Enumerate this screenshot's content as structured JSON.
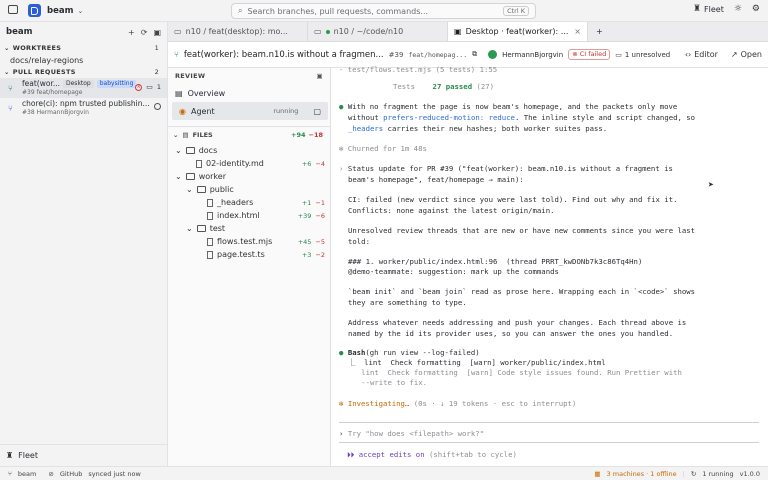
{
  "app": {
    "name": "beam"
  },
  "search": {
    "placeholder": "Search branches, pull requests, commands...",
    "shortcut": "Ctrl K"
  },
  "titlebar_right": {
    "fleet_label": "Fleet"
  },
  "sidebar": {
    "title": "beam",
    "worktrees": {
      "label": "WORKTREES",
      "count": "1",
      "items": [
        "docs/relay-regions"
      ]
    },
    "pull_requests": {
      "label": "PULL REQUESTS",
      "count": "2",
      "items": [
        {
          "title": "feat(wor...",
          "badge1": "Desktop",
          "badge2": "babysitting",
          "sub": "#39 feat/homepage",
          "comments": "1"
        },
        {
          "title": "chore(ci): npm trusted publishin...",
          "sub": "#38 HermannBjorgvin"
        }
      ]
    },
    "fleet_label": "Fleet"
  },
  "tabs": [
    {
      "label": "n10 / feat(desktop): mo..."
    },
    {
      "label": "n10 / ~/code/n10"
    },
    {
      "label": "Desktop · feat(worker): ..."
    }
  ],
  "pr_header": {
    "title": "feat(worker): beam.n10.is without a fragmen...",
    "number": "#39",
    "branch": "feat/homepag...",
    "author": "HermannBjorgvin",
    "ci": "CI failed",
    "unresolved": "1 unresolved",
    "editor": "Editor",
    "open": "Open"
  },
  "review": {
    "label": "REVIEW",
    "overview": "Overview",
    "agent": "Agent",
    "agent_status": "running",
    "files_label": "FILES",
    "files_add": "+94",
    "files_del": "−18",
    "tree": [
      {
        "kind": "folder",
        "name": "docs",
        "depth": 0
      },
      {
        "kind": "file",
        "name": "02-identity.md",
        "depth": 1,
        "add": "+6",
        "del": "−4"
      },
      {
        "kind": "folder",
        "name": "worker",
        "depth": 0
      },
      {
        "kind": "folder",
        "name": "public",
        "depth": 1
      },
      {
        "kind": "file",
        "name": "_headers",
        "depth": 2,
        "add": "+1",
        "del": "−1"
      },
      {
        "kind": "file",
        "name": "index.html",
        "depth": 2,
        "add": "+39",
        "del": "−6"
      },
      {
        "kind": "folder",
        "name": "test",
        "depth": 1
      },
      {
        "kind": "file",
        "name": "flows.test.mjs",
        "depth": 2,
        "add": "+45",
        "del": "−5"
      },
      {
        "kind": "file",
        "name": "page.test.ts",
        "depth": 2,
        "add": "+3",
        "del": "−2"
      }
    ]
  },
  "terminal": {
    "top_file": "- test/flows.test.mjs (5 tests) 1:55",
    "tests_label": "Tests",
    "tests_passed": "27 passed",
    "tests_total": "(27)",
    "p1_a": "With no fragment the page is now beam's homepage, and the packets only move",
    "p1_b1": "without ",
    "p1_b_link": "prefers-reduced-motion: reduce",
    "p1_b2": ". The inline style and script changed, so",
    "p1_c_link": "_headers",
    "p1_c2": " carries their new hashes; both worker suites pass.",
    "churned": "✻ Churned for 1m 48s",
    "status_a": "Status update for PR #39 (\"feat(worker): beam.n10.is without a fragment is",
    "status_b": "beam's homepage\", feat/homepage → main):",
    "ci_line": "CI: failed (new verdict since you were last told). Find out why and fix it.",
    "conflicts": "Conflicts: none against the latest origin/main.",
    "unres_a": "Unresolved review threads that are new or have new comments since you were last",
    "unres_b": "told:",
    "thread_a": "### 1. worker/public/index.html:96  (thread PRRT_kwDONb7k3c86Tq4Hn)",
    "thread_b": "@demo-teammate: suggestion: mark up the commands",
    "sugg_a": "`beam init` and `beam join` read as prose here. Wrapping each in `<code>` shows",
    "sugg_b": "they are something to type.",
    "addr_a": "Address whatever needs addressing and push your changes. Each thread above is",
    "addr_b": "named by the id its provider uses, so you can answer the ones you handled.",
    "bash_cmd": "Bash",
    "bash_args": "(gh run view --log-failed)",
    "bash_out1": "⎿  lint  Check formatting  [warn] worker/public/index.html",
    "bash_out2": "   lint  Check formatting  [warn] Code style issues found. Run Prettier with",
    "bash_out3": "   --write to fix.",
    "investigating": "Investigating…",
    "investigating_meta": " (0s · ↓ 19 tokens · esc to interrupt)",
    "prompt_placeholder": "Try \"how does <filepath> work?\"",
    "accept_label": "⏵⏵ accept edits on",
    "accept_hint": " (shift+tab to cycle)"
  },
  "statusbar": {
    "branch": "beam",
    "github": "GitHub",
    "synced": "synced just now",
    "machines": "3 machines · 1 offline",
    "running": "1 running",
    "version": "v1.0.0"
  }
}
